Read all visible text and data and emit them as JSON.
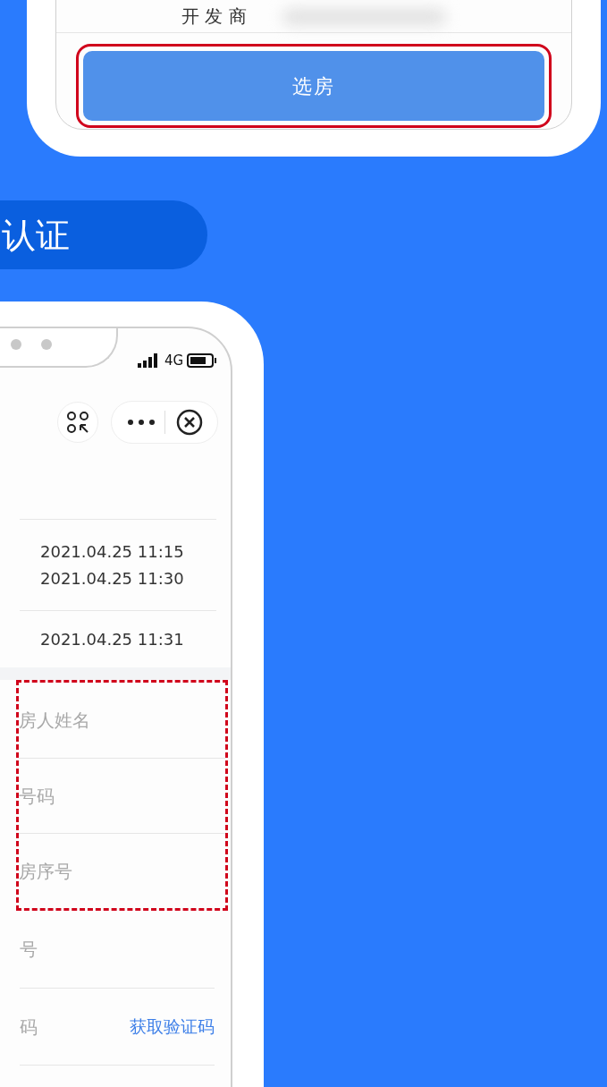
{
  "top_phone": {
    "developer_label": "开 发 商",
    "button": "选房"
  },
  "banner": {
    "title": "认证"
  },
  "bottom_phone": {
    "status_bar": {
      "network": "4G"
    },
    "times": [
      {
        "values": [
          "2021.04.25 11:15",
          "2021.04.25 11:30"
        ]
      },
      {
        "values": [
          "2021.04.25 11:31"
        ]
      }
    ],
    "highlighted_fields": [
      {
        "placeholder": "房人姓名"
      },
      {
        "placeholder": "号码"
      },
      {
        "placeholder": "房序号"
      }
    ],
    "fields": [
      {
        "placeholder": "号"
      },
      {
        "placeholder": "码",
        "action": "获取验证码"
      }
    ]
  }
}
